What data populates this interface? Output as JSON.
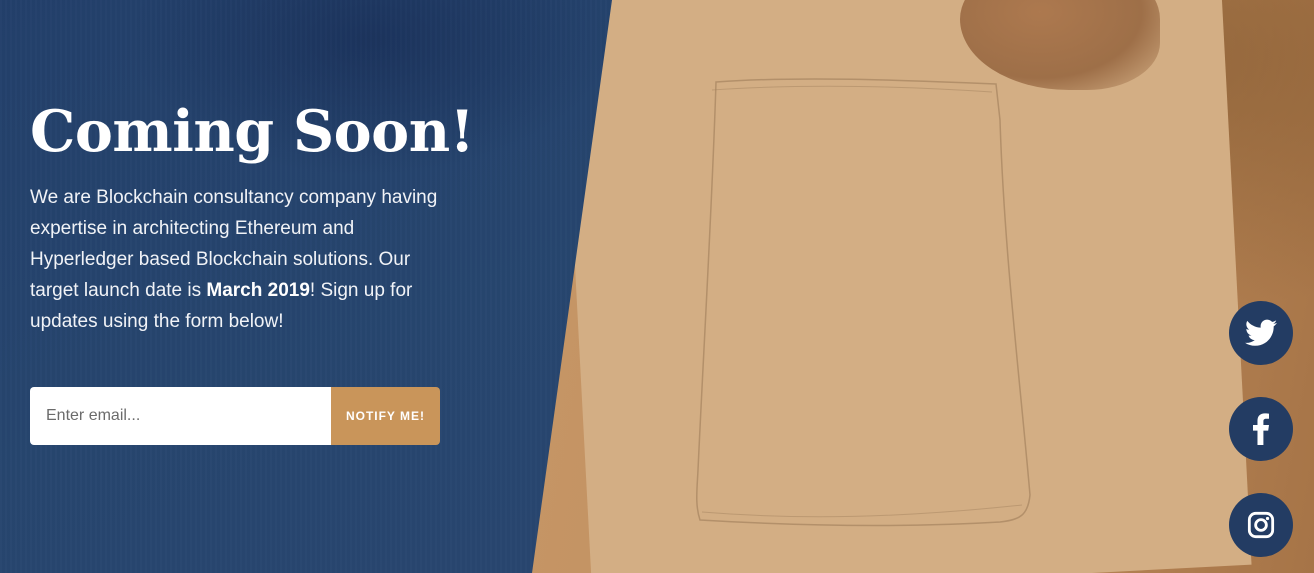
{
  "hero": {
    "title": "Coming Soon!",
    "description_before": "We are Blockchain consultancy company having expertise in architecting Ethereum and Hyperledger based Blockchain solutions. Our target launch date is ",
    "description_highlight": "March 2019",
    "description_after": "! Sign up for updates using the form below!"
  },
  "signup": {
    "email_placeholder": "Enter email...",
    "email_value": "",
    "button_label": "NOTIFY ME!"
  },
  "social": {
    "items": [
      {
        "name": "twitter",
        "icon": "twitter-icon"
      },
      {
        "name": "facebook",
        "icon": "facebook-icon"
      },
      {
        "name": "instagram",
        "icon": "instagram-icon"
      }
    ]
  },
  "colors": {
    "panel_blue": "#27466f",
    "accent_gold": "#c9955a",
    "social_circle": "#233c63"
  }
}
